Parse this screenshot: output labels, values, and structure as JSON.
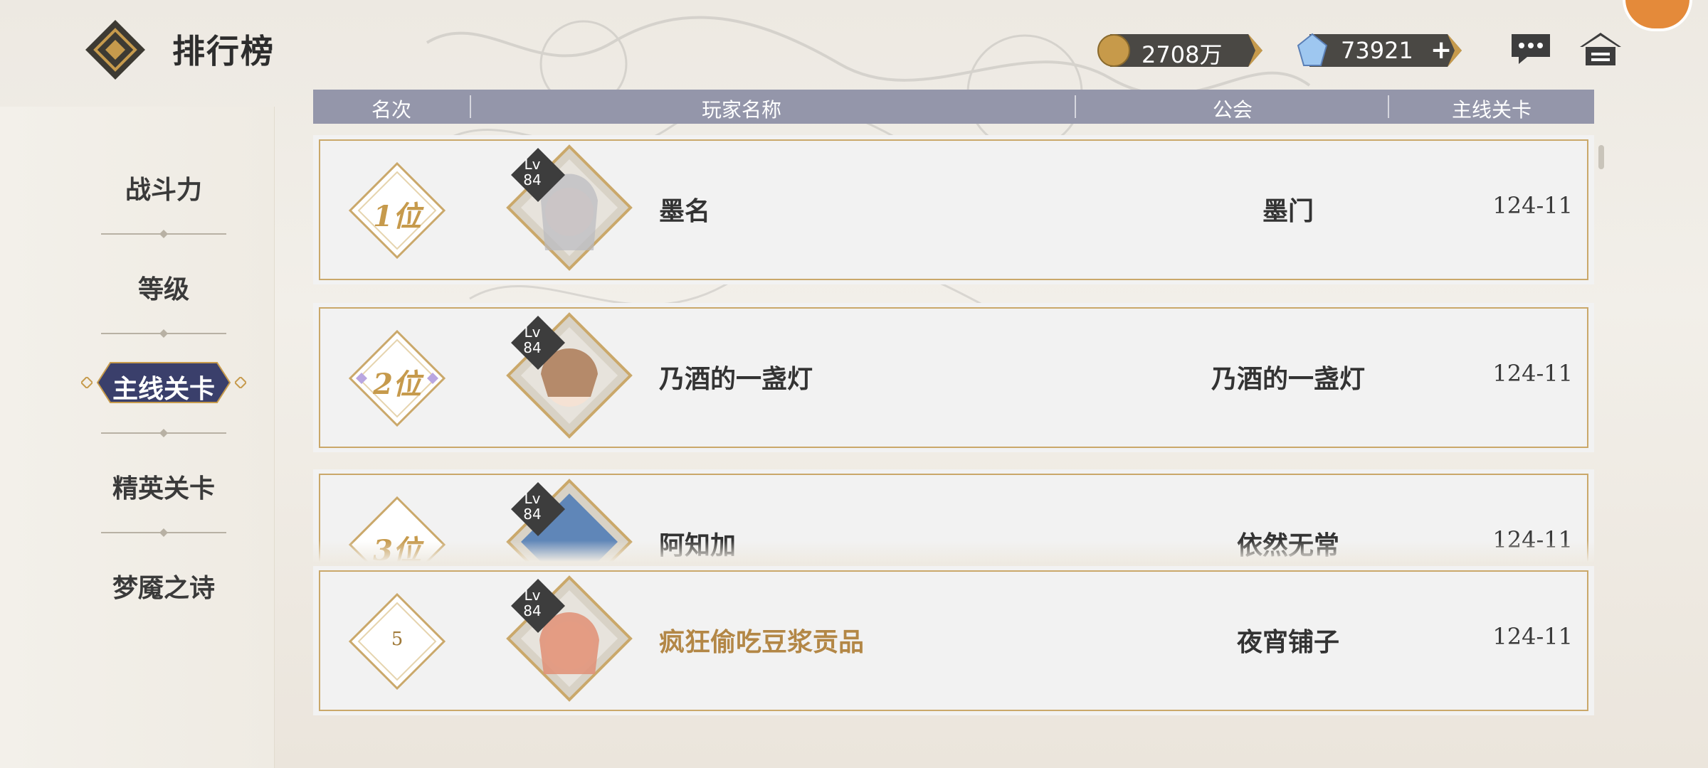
{
  "header": {
    "title": "排行榜",
    "gold_amount": "2708万",
    "gem_amount": "73921",
    "plus_label": "+"
  },
  "sidebar": {
    "items": [
      {
        "label": "战斗力"
      },
      {
        "label": "等级"
      },
      {
        "label": "主线关卡"
      },
      {
        "label": "精英关卡"
      },
      {
        "label": "梦魇之诗"
      }
    ],
    "active_index": 2
  },
  "table": {
    "columns": [
      "名次",
      "玩家名称",
      "公会",
      "主线关卡"
    ],
    "rows": [
      {
        "rank": "1位",
        "lv_label": "Lv",
        "level": "84",
        "name": "墨名",
        "guild": "墨门",
        "stage": "124-11"
      },
      {
        "rank": "2位",
        "lv_label": "Lv",
        "level": "84",
        "name": "乃酒的一盏灯",
        "guild": "乃酒的一盏灯",
        "stage": "124-11"
      },
      {
        "rank": "3位",
        "lv_label": "Lv",
        "level": "84",
        "name": "阿知加",
        "guild": "依然无常",
        "stage": "124-11"
      },
      {
        "rank": "5",
        "lv_label": "Lv",
        "level": "84",
        "name": "疯狂偷吃豆浆贡品",
        "guild": "夜宵铺子",
        "stage": "124-11"
      }
    ]
  },
  "colors": {
    "accent_gold": "#c69a4c",
    "header_bar": "#9496aa",
    "nav_active": "#3a3f6b"
  }
}
